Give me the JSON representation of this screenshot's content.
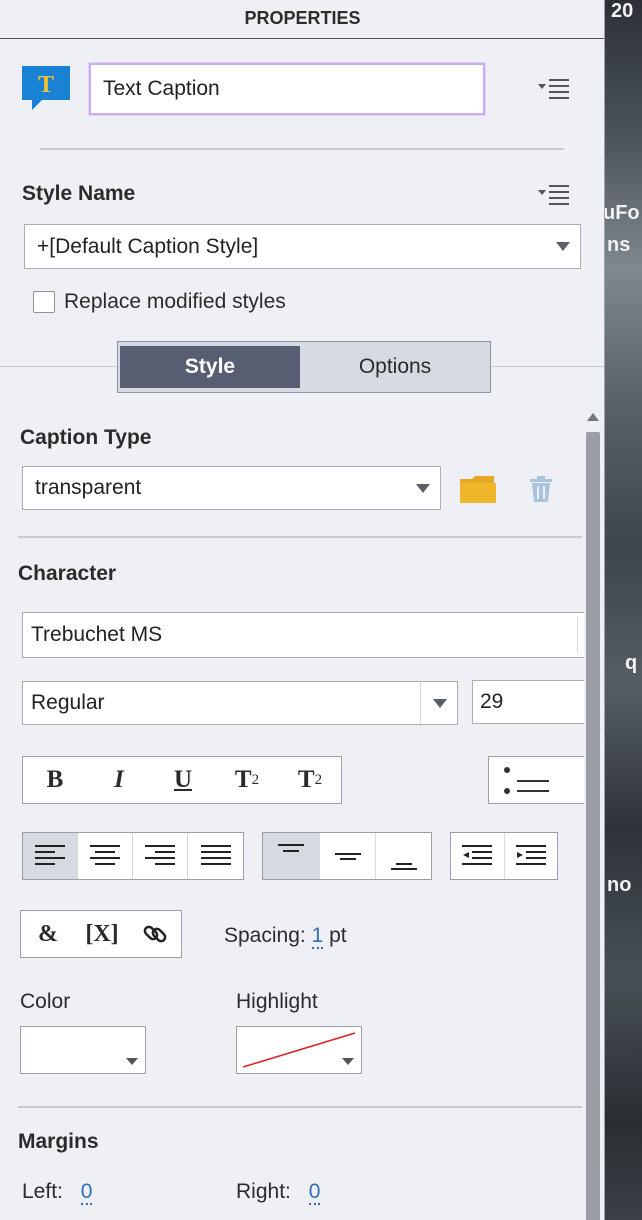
{
  "header": {
    "title": "PROPERTIES"
  },
  "object": {
    "name": "Text Caption",
    "icon_letter": "T",
    "icon": "text-caption-icon"
  },
  "style": {
    "label": "Style Name",
    "selected": "+[Default Caption Style]",
    "replace_label": "Replace modified styles",
    "replace_checked": false
  },
  "tabs": [
    {
      "label": "Style",
      "active": true
    },
    {
      "label": "Options",
      "active": false
    }
  ],
  "caption_type": {
    "label": "Caption Type",
    "selected": "transparent"
  },
  "character": {
    "label": "Character",
    "font": "Trebuchet MS",
    "weight": "Regular",
    "size": "29",
    "format_buttons": [
      "B",
      "I",
      "U",
      "T",
      "T"
    ],
    "superscript_mark": "2",
    "subscript_mark": "2",
    "insert_buttons": [
      "&",
      "[X]"
    ],
    "spacing_label": "Spacing:",
    "spacing_value": "1",
    "spacing_unit": "pt"
  },
  "color": {
    "label": "Color",
    "value": "#ffffff"
  },
  "highlight": {
    "label": "Highlight",
    "value": "none"
  },
  "margins": {
    "label": "Margins",
    "left_label": "Left:",
    "left_value": "0",
    "right_label": "Right:",
    "right_value": "0"
  },
  "backdrop_text": [
    "20",
    "uFo",
    "ns",
    "q",
    "no"
  ],
  "colors": {
    "accent": "#5b6378",
    "icon_blue": "#1a82d4",
    "folder": "#e5a823",
    "focus": "#c8aef0"
  }
}
